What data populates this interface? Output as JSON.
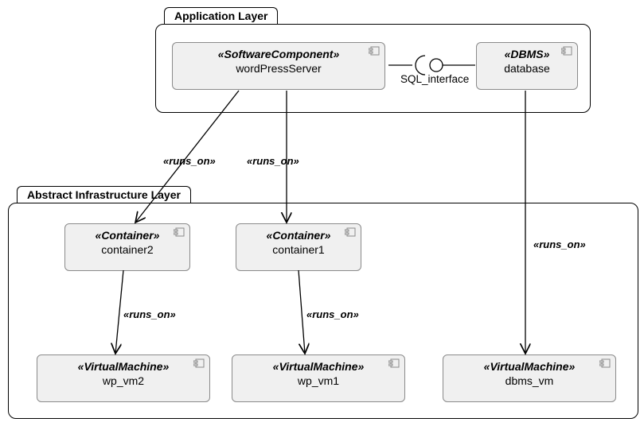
{
  "layers": {
    "app": {
      "title": "Application Layer"
    },
    "infra": {
      "title": "Abstract Infrastructure Layer"
    }
  },
  "nodes": {
    "wordpress": {
      "stereotype": "«SoftwareComponent»",
      "name": "wordPressServer"
    },
    "database": {
      "stereotype": "«DBMS»",
      "name": "database"
    },
    "container2": {
      "stereotype": "«Container»",
      "name": "container2"
    },
    "container1": {
      "stereotype": "«Container»",
      "name": "container1"
    },
    "wp_vm2": {
      "stereotype": "«VirtualMachine»",
      "name": "wp_vm2"
    },
    "wp_vm1": {
      "stereotype": "«VirtualMachine»",
      "name": "wp_vm1"
    },
    "dbms_vm": {
      "stereotype": "«VirtualMachine»",
      "name": "dbms_vm"
    }
  },
  "edges": {
    "runs_on": "«runs_on»",
    "sql_interface": "SQL_interface"
  }
}
